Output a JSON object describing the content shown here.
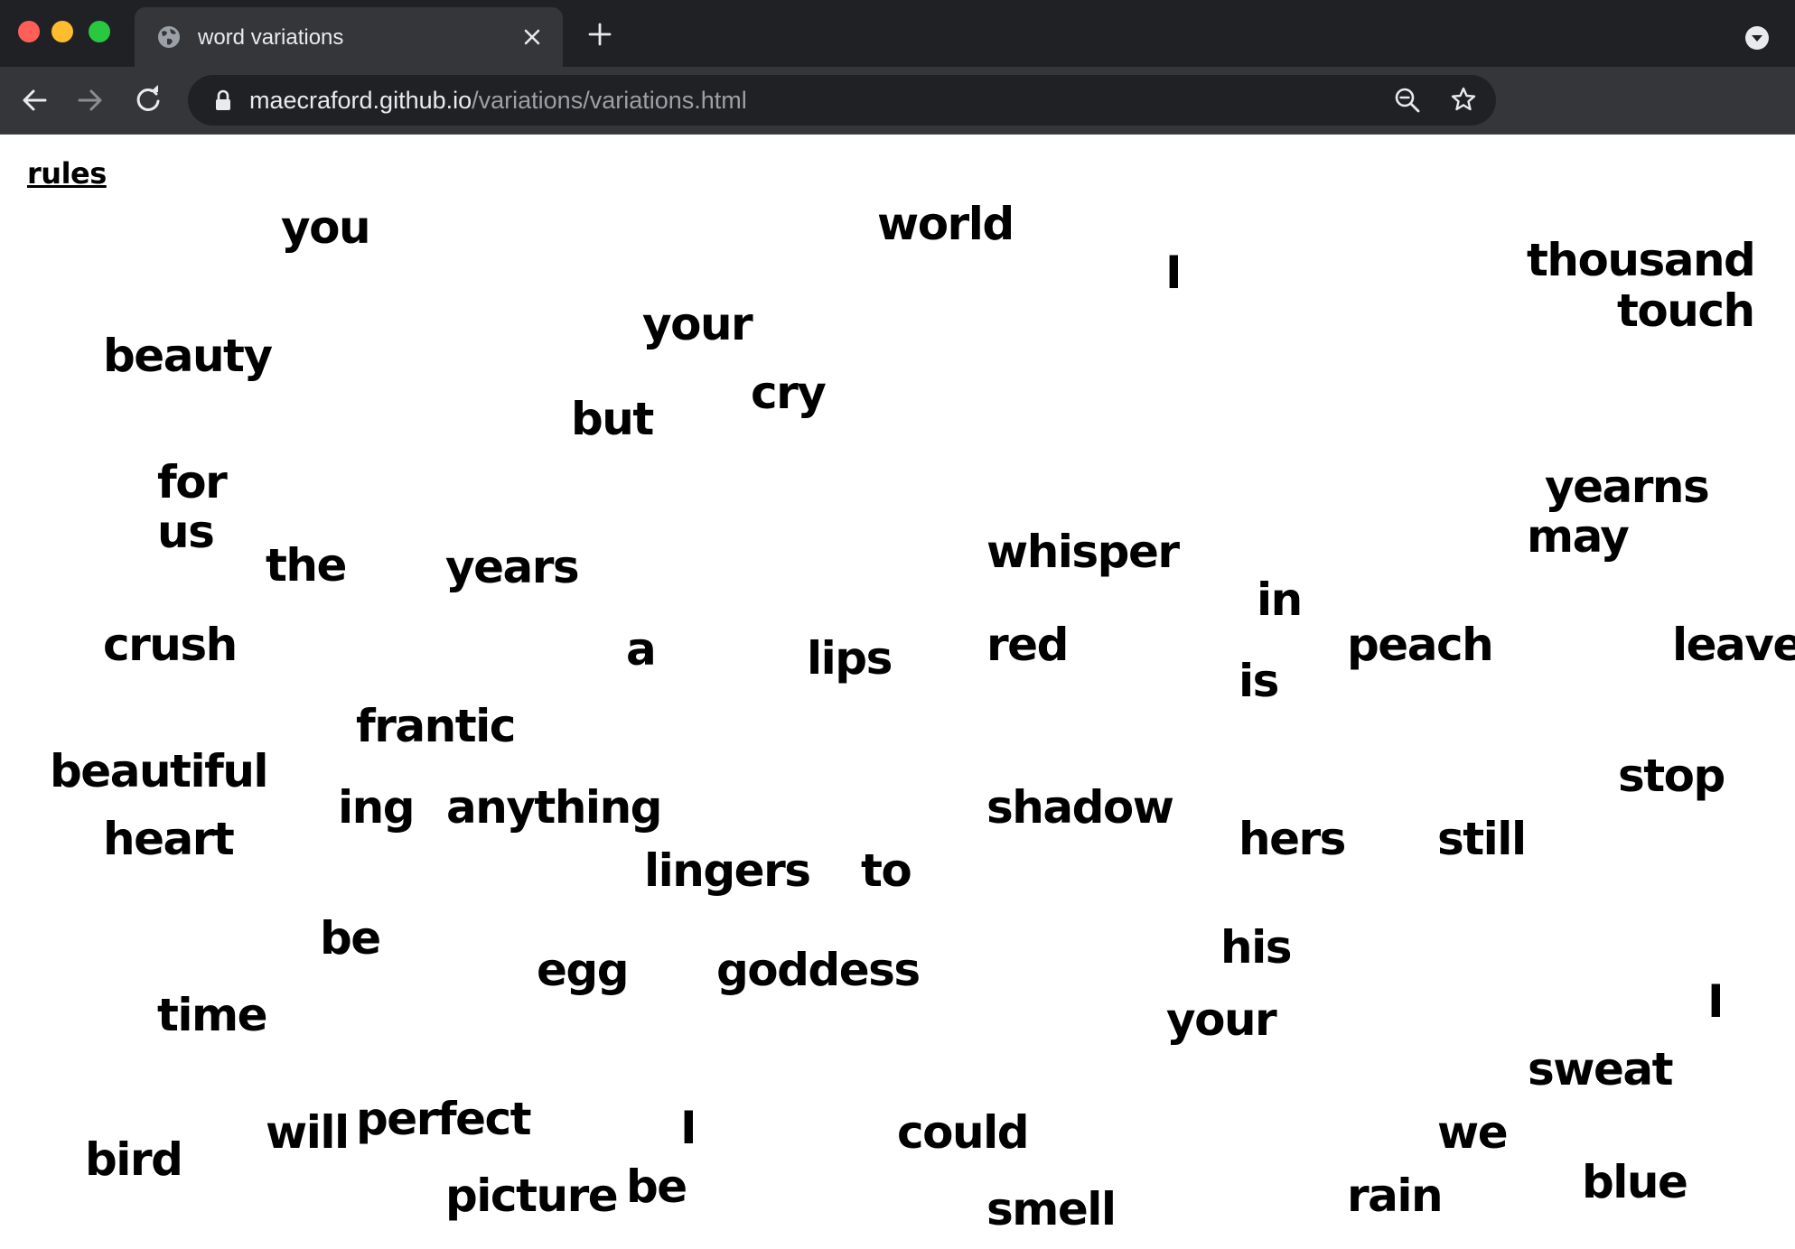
{
  "browser": {
    "tab_title": "word variations",
    "url_host": "maecraford.github.io",
    "url_path": "/variations/variations.html"
  },
  "page": {
    "rules_label": "rules",
    "words": [
      {
        "text": "you"
      },
      {
        "text": "world"
      },
      {
        "text": "I"
      },
      {
        "text": "thousand"
      },
      {
        "text": "touch"
      },
      {
        "text": "your"
      },
      {
        "text": "beauty"
      },
      {
        "text": "cry"
      },
      {
        "text": "but"
      },
      {
        "text": "for"
      },
      {
        "text": "yearns"
      },
      {
        "text": "us"
      },
      {
        "text": "may"
      },
      {
        "text": "the"
      },
      {
        "text": "years"
      },
      {
        "text": "whisper"
      },
      {
        "text": "in"
      },
      {
        "text": "crush"
      },
      {
        "text": "a"
      },
      {
        "text": "lips"
      },
      {
        "text": "red"
      },
      {
        "text": "peach"
      },
      {
        "text": "leave"
      },
      {
        "text": "is"
      },
      {
        "text": "frantic"
      },
      {
        "text": "beautiful"
      },
      {
        "text": "stop"
      },
      {
        "text": "ing"
      },
      {
        "text": "anything"
      },
      {
        "text": "shadow"
      },
      {
        "text": "heart"
      },
      {
        "text": "hers"
      },
      {
        "text": "still"
      },
      {
        "text": "lingers"
      },
      {
        "text": "to"
      },
      {
        "text": "be"
      },
      {
        "text": "his"
      },
      {
        "text": "egg"
      },
      {
        "text": "goddess"
      },
      {
        "text": "time"
      },
      {
        "text": "your"
      },
      {
        "text": "I"
      },
      {
        "text": "sweat"
      },
      {
        "text": "will"
      },
      {
        "text": "perfect"
      },
      {
        "text": "I"
      },
      {
        "text": "could"
      },
      {
        "text": "we"
      },
      {
        "text": "bird"
      },
      {
        "text": "blue"
      },
      {
        "text": "be"
      },
      {
        "text": "picture"
      },
      {
        "text": "rain"
      },
      {
        "text": "smell"
      }
    ]
  }
}
